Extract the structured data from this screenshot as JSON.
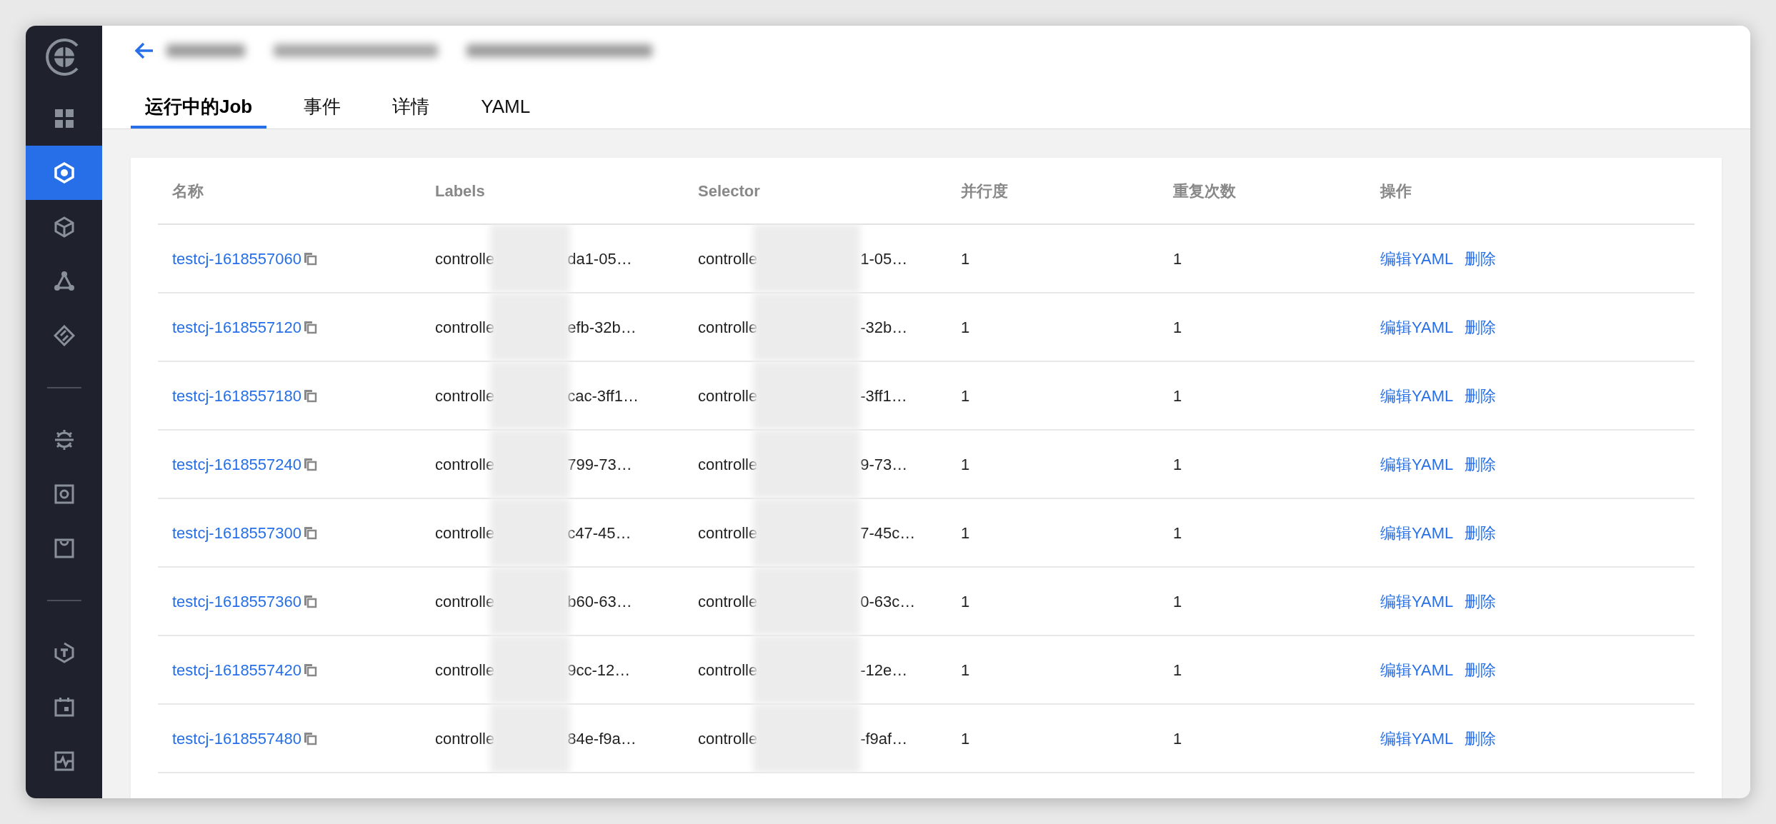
{
  "sidebar": {
    "groups": [
      {
        "items": [
          {
            "kind": "grid",
            "selected": false
          },
          {
            "kind": "hexagon",
            "selected": true
          },
          {
            "kind": "cube",
            "selected": false
          },
          {
            "kind": "nodes",
            "selected": false
          },
          {
            "kind": "diamond",
            "selected": false
          }
        ]
      },
      {
        "items": [
          {
            "kind": "gear",
            "selected": false
          },
          {
            "kind": "disk",
            "selected": false
          },
          {
            "kind": "bag",
            "selected": false
          }
        ]
      },
      {
        "items": [
          {
            "kind": "letter",
            "selected": false
          },
          {
            "kind": "calendar",
            "selected": false
          },
          {
            "kind": "pulse",
            "selected": false
          }
        ]
      }
    ]
  },
  "tabs": [
    {
      "label": "运行中的Job",
      "selected": true
    },
    {
      "label": "事件",
      "selected": false
    },
    {
      "label": "详情",
      "selected": false
    },
    {
      "label": "YAML",
      "selected": false
    }
  ],
  "table": {
    "columns": [
      "名称",
      "Labels",
      "Selector",
      "并行度",
      "重复次数",
      "操作"
    ],
    "rows": [
      {
        "name": "testcj-1618557060",
        "labels": [
          "controlle",
          "da1-05…"
        ],
        "selector": [
          "controlle",
          "1-05…"
        ],
        "parallelism": "1",
        "repeats": "1",
        "actions": [
          "编辑YAML",
          "删除"
        ]
      },
      {
        "name": "testcj-1618557120",
        "labels": [
          "controlle",
          "efb-32b…"
        ],
        "selector": [
          "controlle",
          "-32b…"
        ],
        "parallelism": "1",
        "repeats": "1",
        "actions": [
          "编辑YAML",
          "删除"
        ]
      },
      {
        "name": "testcj-1618557180",
        "labels": [
          "controlle",
          "cac-3ff1…"
        ],
        "selector": [
          "controlle",
          "-3ff1…"
        ],
        "parallelism": "1",
        "repeats": "1",
        "actions": [
          "编辑YAML",
          "删除"
        ]
      },
      {
        "name": "testcj-1618557240",
        "labels": [
          "controlle",
          "799-73…"
        ],
        "selector": [
          "controlle",
          "9-73…"
        ],
        "parallelism": "1",
        "repeats": "1",
        "actions": [
          "编辑YAML",
          "删除"
        ]
      },
      {
        "name": "testcj-1618557300",
        "labels": [
          "controlle",
          "c47-45…"
        ],
        "selector": [
          "controlle",
          "7-45c…"
        ],
        "parallelism": "1",
        "repeats": "1",
        "actions": [
          "编辑YAML",
          "删除"
        ]
      },
      {
        "name": "testcj-1618557360",
        "labels": [
          "controlle",
          "b60-63…"
        ],
        "selector": [
          "controlle",
          "0-63c…"
        ],
        "parallelism": "1",
        "repeats": "1",
        "actions": [
          "编辑YAML",
          "删除"
        ]
      },
      {
        "name": "testcj-1618557420",
        "labels": [
          "controlle",
          "9cc-12…"
        ],
        "selector": [
          "controlle",
          "-12e…"
        ],
        "parallelism": "1",
        "repeats": "1",
        "actions": [
          "编辑YAML",
          "删除"
        ]
      },
      {
        "name": "testcj-1618557480",
        "labels": [
          "controlle",
          "84e-f9a…"
        ],
        "selector": [
          "controlle",
          "-f9af…"
        ],
        "parallelism": "1",
        "repeats": "1",
        "actions": [
          "编辑YAML",
          "删除"
        ]
      }
    ]
  }
}
